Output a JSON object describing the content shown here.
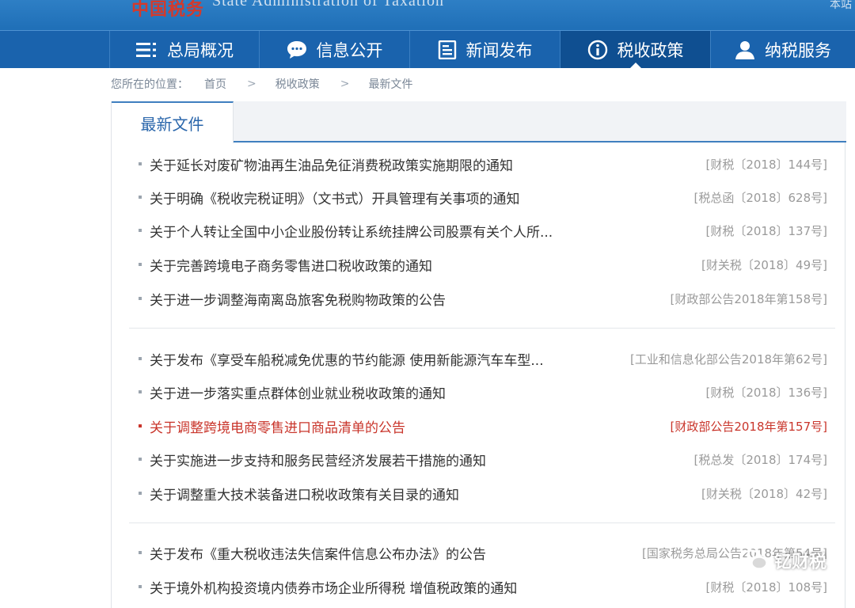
{
  "header": {
    "logo": "中国税务",
    "subtitle_en": "State Administration of Taxation",
    "right_text": "本站"
  },
  "nav": {
    "items": [
      {
        "label": "总局概况",
        "icon": "list-icon"
      },
      {
        "label": "信息公开",
        "icon": "speech-bubble-icon"
      },
      {
        "label": "新闻发布",
        "icon": "document-icon"
      },
      {
        "label": "税收政策",
        "icon": "info-icon",
        "active": true
      },
      {
        "label": "纳税服务",
        "icon": "user-icon"
      }
    ]
  },
  "breadcrumb": {
    "label": "您所在的位置：",
    "items": [
      "首页",
      "税收政策",
      "最新文件"
    ],
    "separator": ">"
  },
  "panel": {
    "tab": "最新文件"
  },
  "documents": [
    {
      "title": "关于延长对废矿物油再生油品免征消费税政策实施期限的通知",
      "code": "[财税〔2018〕144号]"
    },
    {
      "title": "关于明确《税收完税证明》（文书式）开具管理有关事项的通知",
      "code": "[税总函〔2018〕628号]"
    },
    {
      "title": "关于个人转让全国中小企业股份转让系统挂牌公司股票有关个人所...",
      "code": "[财税〔2018〕137号]"
    },
    {
      "title": "关于完善跨境电子商务零售进口税收政策的通知",
      "code": "[财关税〔2018〕49号]"
    },
    {
      "title": "关于进一步调整海南离岛旅客免税购物政策的公告",
      "code": "[财政部公告2018年第158号]"
    },
    {
      "title": "关于发布《享受车船税减免优惠的节约能源 使用新能源汽车车型...",
      "code": "[工业和信息化部公告2018年第62号]"
    },
    {
      "title": "关于进一步落实重点群体创业就业税收政策的通知",
      "code": "[财税〔2018〕136号]"
    },
    {
      "title": "关于调整跨境电商零售进口商品清单的公告",
      "code": "[财政部公告2018年第157号]",
      "highlight": true
    },
    {
      "title": "关于实施进一步支持和服务民营经济发展若干措施的通知",
      "code": "[税总发〔2018〕174号]"
    },
    {
      "title": "关于调整重大技术装备进口税收政策有关目录的通知",
      "code": "[财关税〔2018〕42号]"
    },
    {
      "title": "关于发布《重大税收违法失信案件信息公布办法》的公告",
      "code": "[国家税务总局公告2018年第54号]"
    },
    {
      "title": "关于境外机构投资境内债券市场企业所得税 增值税政策的通知",
      "code": "[财税〔2018〕108号]"
    }
  ],
  "watermark": {
    "text": "钇财税",
    "icon": "wechat-icon"
  },
  "colors": {
    "nav_bg": "#1a63ad",
    "nav_active": "#0f4f91",
    "tab_accent": "#3f7fbf",
    "highlight": "#c9352b"
  }
}
